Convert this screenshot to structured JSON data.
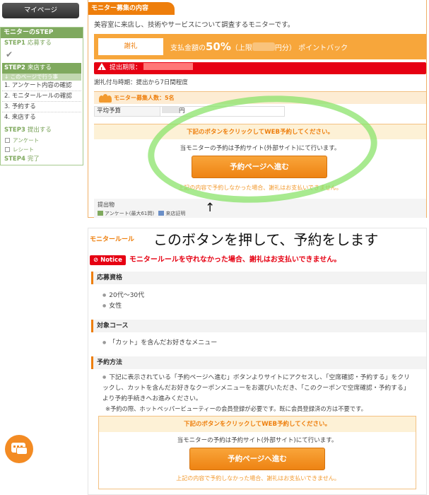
{
  "sidebar": {
    "mypage_label": "マイページ",
    "steps_title": "モニターのSTEP",
    "step1": {
      "num": "STEP1",
      "label": "応募する"
    },
    "step2": {
      "num": "STEP2",
      "label": "来店する"
    },
    "step2_sub_title": "このページで行う事",
    "step2_items": [
      "1. アンケート内容の確認",
      "2. モニタールールの確認",
      "3. 予約する",
      "4. 来店する"
    ],
    "step3": {
      "num": "STEP3",
      "label": "提出する"
    },
    "step3_items": [
      "アンケート",
      "レシート"
    ],
    "step4": {
      "num": "STEP4",
      "label": "完了"
    }
  },
  "recruit": {
    "tab_title": "モニター募集の内容",
    "intro": "美容室に来店し、技術やサービスについて調査するモニターです。",
    "reward_label": "謝礼",
    "reward_prefix": "支払金額の",
    "reward_pct": "50%",
    "reward_limit_prefix": "（上限",
    "reward_limit_suffix": "円分）",
    "reward_suffix": "ポイントバック",
    "deadline_label": "提出期限：",
    "timing": "謝礼付与時期：提出から7日間程度",
    "count_label": "モニター募集人数：5名",
    "budget_key": "平均予算",
    "budget_unit": "円",
    "notice": "下記のボタンをクリックしてWEB予約してください。",
    "external": "当モニターの予約は予約サイト(外部サイト)にて行います。",
    "button": "予約ページへ進む",
    "warning": "上記の内容で予約しなかった場合、謝礼はお支払いできません。",
    "submit_title": "提出物",
    "submit_survey": "アンケート(最大61問)",
    "submit_receipt": "来店証明",
    "arrow": "↑"
  },
  "rules": {
    "title": "モニタールール",
    "callout": "このボタンを押して、予約をします",
    "notice_badge": "Notice",
    "notice_text": "モニタールールを守れなかった場合、謝礼はお支払いできません。",
    "eligibility_title": "応募資格",
    "eligibility": [
      "20代〜30代",
      "女性"
    ],
    "course_title": "対象コース",
    "course": [
      "「カット」を含んだお好きなメニュー"
    ],
    "method_title": "予約方法",
    "method_text": "下記に表示されている「予約ページへ進む」ボタンよりサイトにアクセスし、「空席確認・予約する」をクリックし、カットを含んだお好きなクーポンメニューをお選びいただき、「このクーポンで空席確認・予約する」より予約手続きへお進みください。",
    "method_note": "※予約の際、ホットペッパービューティーの会員登録が必要です。既に会員登録済の方は不要です。",
    "notice2": "下記のボタンをクリックしてWEB予約してください。",
    "external2": "当モニターの予約は予約サイト(外部サイト)にて行います。",
    "button2": "予約ページへ進む",
    "warning2": "上記の内容で予約しなかった場合、謝礼はお支払いできません。"
  },
  "colors": {
    "accent": "#ee7e0b",
    "step_green": "#7fa95e",
    "alert_red": "#e60012",
    "highlight_green": "#8be36b"
  },
  "icons": {
    "chat": "chat-bubble-icon",
    "check": "check-icon",
    "warning": "warning-icon",
    "people": "people-icon"
  }
}
